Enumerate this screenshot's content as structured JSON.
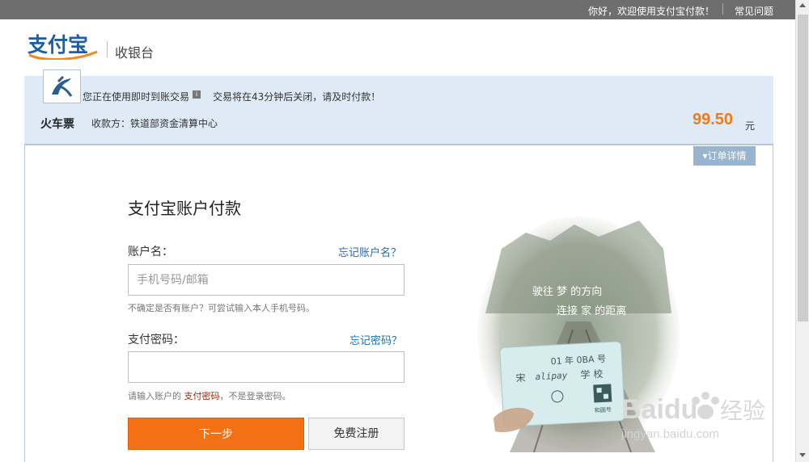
{
  "topbar": {
    "welcome": "你好，欢迎使用支付宝付款！",
    "faq": "常见问题"
  },
  "header": {
    "logo_text": "支付宝",
    "title": "收银台"
  },
  "order": {
    "notice_trade": "您正在使用即时到账交易",
    "notice_close": "交易将在43分钟后关闭，请及时付款！",
    "product": "火车票",
    "payee": "收款方：铁道部资金清算中心",
    "amount": "99.50",
    "currency": "元",
    "details_button": "▾订单详情"
  },
  "form": {
    "title": "支付宝账户付款",
    "account_label": "账户名：",
    "forgot_account": "忘记账户名？",
    "account_placeholder": "手机号码/邮箱",
    "account_hint": "不确定是否有账户？可尝试输入本人手机号码。",
    "password_label": "支付密码：",
    "forgot_password": "忘记密码？",
    "password_hint_pre": "请输入账户的",
    "password_hint_hl": "支付密码",
    "password_hint_post": "，不是登录密码。",
    "next_button": "下一步",
    "register_button": "免费注册"
  },
  "promo": {
    "line1": "驶往 梦 的方向",
    "line2": "连接 家 的距离",
    "ticket_top": "01 年 0BA 号",
    "ticket_left": "宋",
    "ticket_mid": "alipay",
    "ticket_right": "学 校",
    "ticket_bottom": "和圆号"
  },
  "watermark": {
    "brand": "Baidu",
    "brand_cn": "经验",
    "url": "jingyan.baidu.com"
  },
  "colors": {
    "accent": "#f37015",
    "link": "#1b6fb8",
    "amount": "#ef7b18",
    "order_bg": "#dfeaf7",
    "topbar": "#6e6e6e"
  }
}
